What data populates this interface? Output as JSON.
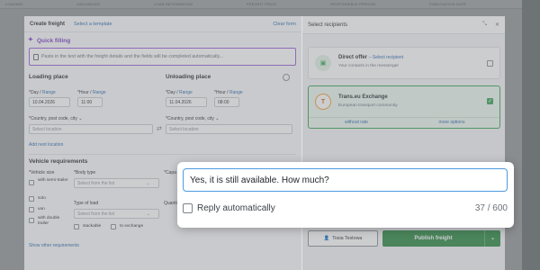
{
  "background": {
    "columns": [
      "LOADING",
      "UNLOADING",
      "LOAD INFORMATION",
      "FREIGHT PRICE",
      "RESPONSIBLE PERSON",
      "PUBLICATION DATE"
    ]
  },
  "freight_form": {
    "title": "Create freight",
    "template_link": "Select a template",
    "clear_link": "Clear form",
    "quick_fill": {
      "title": "Quick filling",
      "placeholder": "Paste in the text with the freight details and the fields will be completed automatically..."
    },
    "loading": {
      "title": "Loading place",
      "day_label": "*Day /",
      "day_range": "Range",
      "day_value": "10.04.2026",
      "hour_label": "*Hour /",
      "hour_range": "Range",
      "hour_value": "11:00",
      "country_label": "*Country, post code, city",
      "location_placeholder": "Select location",
      "add_location": "Add next location"
    },
    "unloading": {
      "title": "Unloading place",
      "day_label": "*Day /",
      "day_range": "Range",
      "day_value": "11.04.2026",
      "hour_label": "*Hour /",
      "hour_range": "Range",
      "hour_value": "08:00",
      "country_label": "*Country, post code, city",
      "location_placeholder": "Select location"
    },
    "vehicle": {
      "title": "Vehicle requirements",
      "size_label": "*Vehicle size",
      "sizes": [
        "with semi-trailer",
        "solo",
        "van",
        "with double trailer"
      ],
      "body_label": "*Body type",
      "body_placeholder": "Select from the list",
      "capacity_label": "*Capa",
      "load_label": "Type of load",
      "load_placeholder": "Select from the list",
      "quantity_label": "Quanti",
      "stackable": "stackable",
      "to_exchange": "to exchange",
      "show_other": "Show other requirements"
    }
  },
  "recipients": {
    "title": "Select recipients",
    "direct": {
      "title": "Direct offer",
      "link": "– Select recipient",
      "subtitle": "Your contacts in the messenger"
    },
    "exchange": {
      "title": "Trans.eu Exchange",
      "subtitle": "European transport community",
      "without_rate": "without rate",
      "more_options": "more options"
    },
    "user": "Tosia Testowa",
    "publish": "Publish freight"
  },
  "popup": {
    "reply_value": "Yes, it is still available. How much?",
    "auto_label": "Reply automatically",
    "counter": "37 / 600"
  },
  "colors": {
    "accent_purple": "#7b3fc4",
    "link_blue": "#2b6cb0",
    "publish_green": "#2e8b45",
    "focus_blue": "#4c9be0"
  }
}
